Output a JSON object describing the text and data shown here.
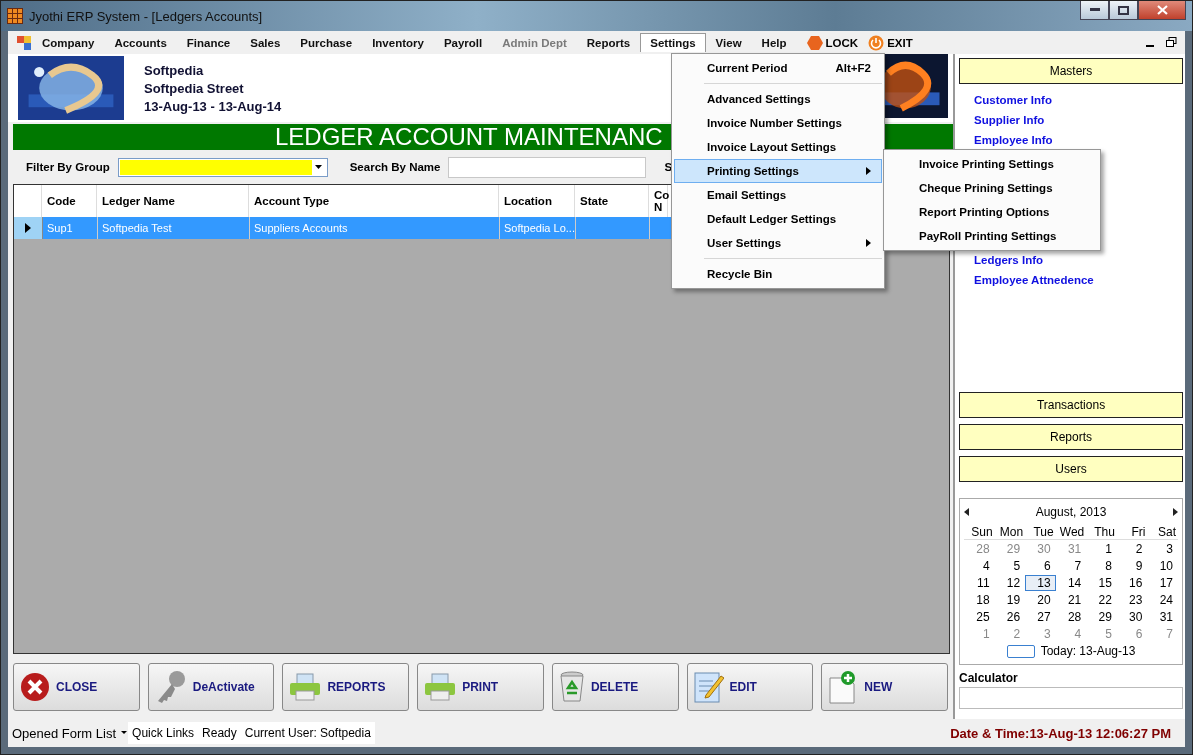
{
  "window": {
    "title": "Jyothi ERP System - [Ledgers Accounts]"
  },
  "menu_bar": {
    "items": [
      {
        "label": "Company",
        "disabled": false,
        "selected": false
      },
      {
        "label": "Accounts",
        "disabled": false,
        "selected": false
      },
      {
        "label": "Finance",
        "disabled": false,
        "selected": false
      },
      {
        "label": "Sales",
        "disabled": false,
        "selected": false
      },
      {
        "label": "Purchase",
        "disabled": false,
        "selected": false
      },
      {
        "label": "Inventory",
        "disabled": false,
        "selected": false
      },
      {
        "label": "Payroll",
        "disabled": false,
        "selected": false
      },
      {
        "label": "Admin Dept",
        "disabled": true,
        "selected": false
      },
      {
        "label": "Reports",
        "disabled": false,
        "selected": false
      },
      {
        "label": "Settings",
        "disabled": false,
        "selected": true
      },
      {
        "label": "View",
        "disabled": false,
        "selected": false
      },
      {
        "label": "Help",
        "disabled": false,
        "selected": false
      }
    ],
    "actions": [
      {
        "kind": "lock",
        "label": "LOCK"
      },
      {
        "kind": "exit",
        "label": "EXIT"
      }
    ]
  },
  "company": {
    "name": "Softpedia",
    "street": "Softpedia Street",
    "period": "13-Aug-13 - 13-Aug-14"
  },
  "form": {
    "title": "LEDGER ACCOUNT MAINTENANC",
    "filter_label": "Filter By Group",
    "search_label": "Search By Name",
    "search_label_2": "S",
    "columns": [
      "Code",
      "Ledger Name",
      "Account Type",
      "Location",
      "State",
      "Co N"
    ],
    "rows": [
      {
        "cells": [
          "Sup1",
          "Softpedia Test",
          "Suppliers Accounts",
          "Softpedia Lo...",
          ""
        ],
        "selected": true
      }
    ]
  },
  "buttons": [
    {
      "kind": "close",
      "label": "CLOSE"
    },
    {
      "kind": "key",
      "label": "DeActivate"
    },
    {
      "kind": "printer",
      "label": "REPORTS"
    },
    {
      "kind": "printer",
      "label": "PRINT"
    },
    {
      "kind": "recycle",
      "label": "DELETE"
    },
    {
      "kind": "notepad",
      "label": "EDIT"
    },
    {
      "kind": "new",
      "label": "NEW"
    }
  ],
  "settings_menu": [
    {
      "kind": "item",
      "label": "Current Period",
      "shortcut": "Alt+F2",
      "submenu": false,
      "selected": false
    },
    {
      "kind": "separator"
    },
    {
      "kind": "item",
      "label": "Advanced Settings",
      "submenu": false,
      "selected": false
    },
    {
      "kind": "item",
      "label": "Invoice Number Settings",
      "submenu": false,
      "selected": false
    },
    {
      "kind": "item",
      "label": "Invoice Layout Settings",
      "submenu": false,
      "selected": false
    },
    {
      "kind": "item",
      "label": "Printing Settings",
      "submenu": true,
      "selected": true
    },
    {
      "kind": "item",
      "label": "Email Settings",
      "submenu": false,
      "selected": false
    },
    {
      "kind": "item",
      "label": "Default Ledger Settings",
      "submenu": false,
      "selected": false
    },
    {
      "kind": "item",
      "label": "User Settings",
      "submenu": true,
      "selected": false
    },
    {
      "kind": "separator"
    },
    {
      "kind": "item",
      "label": "Recycle Bin",
      "submenu": false,
      "selected": false
    }
  ],
  "printing_submenu": [
    "Invoice Printing Settings",
    "Cheque Prining Settings",
    "Report Printing Options",
    "PayRoll Printing Settings"
  ],
  "sidebar": {
    "masters": "Masters",
    "links_top": [
      "Customer Info",
      "Supplier Info",
      "Employee Info"
    ],
    "links_bottom": [
      "Ledgers Info",
      "Employee Attnedence"
    ],
    "sections": [
      "Transactions",
      "Reports",
      "Users"
    ]
  },
  "calendar": {
    "month": "August, 2013",
    "weekdays": [
      "Sun",
      "Mon",
      "Tue",
      "Wed",
      "Thu",
      "Fri",
      "Sat"
    ],
    "days": [
      {
        "d": "28",
        "dim": true,
        "selected": false
      },
      {
        "d": "29",
        "dim": true,
        "selected": false
      },
      {
        "d": "30",
        "dim": true,
        "selected": false
      },
      {
        "d": "31",
        "dim": true,
        "selected": false
      },
      {
        "d": "1",
        "dim": false,
        "selected": false
      },
      {
        "d": "2",
        "dim": false,
        "selected": false
      },
      {
        "d": "3",
        "dim": false,
        "selected": false
      },
      {
        "d": "4",
        "dim": false,
        "selected": false
      },
      {
        "d": "5",
        "dim": false,
        "selected": false
      },
      {
        "d": "6",
        "dim": false,
        "selected": false
      },
      {
        "d": "7",
        "dim": false,
        "selected": false
      },
      {
        "d": "8",
        "dim": false,
        "selected": false
      },
      {
        "d": "9",
        "dim": false,
        "selected": false
      },
      {
        "d": "10",
        "dim": false,
        "selected": false
      },
      {
        "d": "11",
        "dim": false,
        "selected": false
      },
      {
        "d": "12",
        "dim": false,
        "selected": false
      },
      {
        "d": "13",
        "dim": false,
        "selected": true
      },
      {
        "d": "14",
        "dim": false,
        "selected": false
      },
      {
        "d": "15",
        "dim": false,
        "selected": false
      },
      {
        "d": "16",
        "dim": false,
        "selected": false
      },
      {
        "d": "17",
        "dim": false,
        "selected": false
      },
      {
        "d": "18",
        "dim": false,
        "selected": false
      },
      {
        "d": "19",
        "dim": false,
        "selected": false
      },
      {
        "d": "20",
        "dim": false,
        "selected": false
      },
      {
        "d": "21",
        "dim": false,
        "selected": false
      },
      {
        "d": "22",
        "dim": false,
        "selected": false
      },
      {
        "d": "23",
        "dim": false,
        "selected": false
      },
      {
        "d": "24",
        "dim": false,
        "selected": false
      },
      {
        "d": "25",
        "dim": false,
        "selected": false
      },
      {
        "d": "26",
        "dim": false,
        "selected": false
      },
      {
        "d": "27",
        "dim": false,
        "selected": false
      },
      {
        "d": "28",
        "dim": false,
        "selected": false
      },
      {
        "d": "29",
        "dim": false,
        "selected": false
      },
      {
        "d": "30",
        "dim": false,
        "selected": false
      },
      {
        "d": "31",
        "dim": false,
        "selected": false
      },
      {
        "d": "1",
        "dim": true,
        "selected": false
      },
      {
        "d": "2",
        "dim": true,
        "selected": false
      },
      {
        "d": "3",
        "dim": true,
        "selected": false
      },
      {
        "d": "4",
        "dim": true,
        "selected": false
      },
      {
        "d": "5",
        "dim": true,
        "selected": false
      },
      {
        "d": "6",
        "dim": true,
        "selected": false
      },
      {
        "d": "7",
        "dim": true,
        "selected": false
      }
    ],
    "today": "Today: 13-Aug-13"
  },
  "calculator": {
    "label": "Calculator"
  },
  "status_bar": {
    "form_list": "Opened Form List",
    "quick_links": "Quick Links",
    "state": "Ready",
    "user": "Current User: Softpedia",
    "datetime": "Date & Time:13-Aug-13 12:06:27 PM"
  }
}
